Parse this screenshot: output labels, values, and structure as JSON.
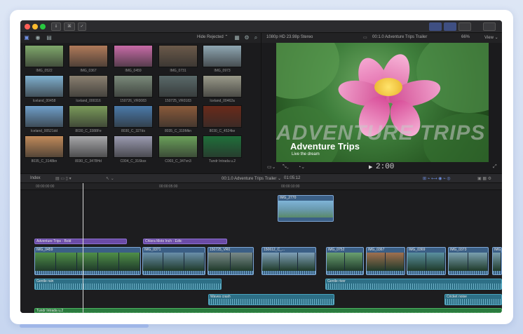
{
  "browser": {
    "filter_label": "Hide Rejected ⌃",
    "clips": [
      {
        "name": "IMG_0522",
        "color": "#7fa86b"
      },
      {
        "name": "IMG_0367",
        "color": "#b07a5a"
      },
      {
        "name": "IMG_0459",
        "color": "#c86ba7"
      },
      {
        "name": "IMG_0731",
        "color": "#6b5a4a"
      },
      {
        "name": "IMG_0973",
        "color": "#8fa7b3"
      },
      {
        "name": "Iceland_00458",
        "color": "#7fb0d0"
      },
      {
        "name": "Iceland_000316",
        "color": "#8a8070"
      },
      {
        "name": "150726_VR0083",
        "color": "#7a8a7a"
      },
      {
        "name": "150725_VR0183",
        "color": "#5a6a6a"
      },
      {
        "name": "Iceland_00462a",
        "color": "#9a9a8a"
      },
      {
        "name": "Iceland_00521dd",
        "color": "#6f9fca"
      },
      {
        "name": "8030_C_3388Fe",
        "color": "#7a9a5a"
      },
      {
        "name": "8030_C_327ds",
        "color": "#4a7aaa"
      },
      {
        "name": "8035_C_319Mkn",
        "color": "#8a5a3a"
      },
      {
        "name": "8030_C_4524ke",
        "color": "#6a2a1a"
      },
      {
        "name": "8035_C_3148kn",
        "color": "#c08a5a"
      },
      {
        "name": "8030_C_3478Hd",
        "color": "#a7a7aa"
      },
      {
        "name": "C004_C_316ksx",
        "color": "#9a9ab0"
      },
      {
        "name": "C003_C_347vn3",
        "color": "#6aa05a"
      },
      {
        "name": "Tundr Intrada u.2",
        "color": "#1f6f3a"
      }
    ]
  },
  "viewer": {
    "format": "1080p HD 23.98p Stereo",
    "project": "00:1.0 Adventure Trips Trailer",
    "zoom": "66%",
    "view_label": "View ⌄",
    "title_big": "ADVENTURE TRIPS",
    "title": "Adventure Trips",
    "subtitle": "Live the dream",
    "timecode": "2:00"
  },
  "timeline": {
    "index_label": "Index",
    "project_name": "00:1.0 Adventure Trips Trailer ⌄",
    "duration": "01:05:12",
    "ruler": [
      "00:00:00:00",
      "00:00:05:00",
      "00:00:10:00"
    ],
    "connected_clip": "IMG_2770",
    "titles": [
      {
        "label": "Adventure Trips - Bold"
      },
      {
        "label": "Chlora Moto Inch - Edtc"
      }
    ],
    "primary_clips": [
      {
        "label": "IMG_0459"
      },
      {
        "label": "IMG_0371"
      },
      {
        "label": "150725_VR0"
      },
      {
        "label": "150612_C_..."
      },
      {
        "label": "IMG_0752"
      },
      {
        "label": "IMG_0367"
      },
      {
        "label": "IMG_0369"
      },
      {
        "label": "IMG_0373"
      },
      {
        "label": "IMG_..."
      }
    ],
    "audio_clips": [
      {
        "label": "Gentle rain"
      },
      {
        "label": "Gentle river"
      },
      {
        "label": "Waves crash"
      },
      {
        "label": "Cricket noise"
      }
    ],
    "music": "Tundr Intrada u.2"
  },
  "colors": {
    "accent": "#7ea7d6",
    "music": "#2a7a3e",
    "titles": "#6b4ba6"
  }
}
